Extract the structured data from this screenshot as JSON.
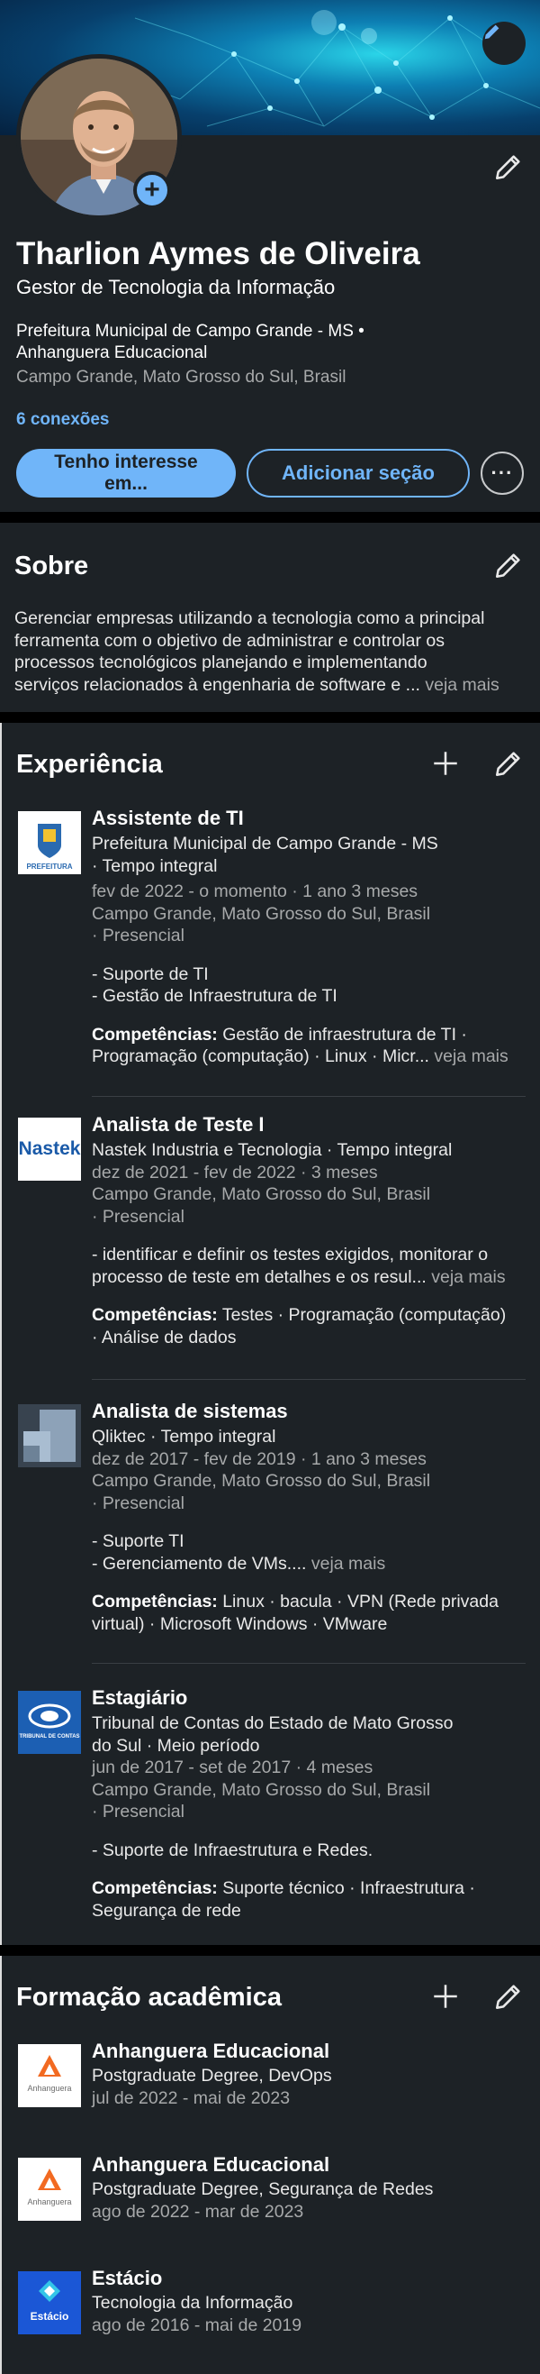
{
  "profile": {
    "name": "Tharlion Aymes de Oliveira",
    "headline": "Gestor de Tecnologia da Informação",
    "orgs_line1": "Prefeitura Municipal de Campo Grande - MS •",
    "orgs_line2": "Anhanguera Educacional",
    "location": "Campo Grande, Mato Grosso do Sul, Brasil",
    "connections": "6 conexões",
    "open_to_line1": "Tenho interesse",
    "open_to_line2": "em...",
    "add_section": "Adicionar seção",
    "more": "···"
  },
  "about": {
    "title": "Sobre",
    "text_lines": [
      "Gerenciar empresas utilizando a tecnologia como a principal",
      "ferramenta com o objetivo de administrar  e controlar os",
      "processos tecnológicos planejando e implementando",
      "serviços relacionados à engenharia de software e ..."
    ],
    "see_more": "veja mais"
  },
  "experience": {
    "title": "Experiência",
    "items": [
      {
        "role": "Assistente de TI",
        "company_line1": "Prefeitura Municipal de Campo Grande - MS",
        "company_line2": "· Tempo integral",
        "dates": "fev de 2022 - o momento · 1 ano 3 meses",
        "location_line1": "Campo Grande, Mato Grosso do Sul, Brasil",
        "location_line2": "· Presencial",
        "desc_line1": "- Suporte de TI",
        "desc_line2": "- Gestão de Infraestrutura de TI",
        "skills_label": "Competências:",
        "skills_line1": " Gestão de infraestrutura de TI ·",
        "skills_line2": "Programação (computação) · Linux · Micr...",
        "see_more": "veja mais",
        "logo_text": "PREFEITURA"
      },
      {
        "role": "Analista de Teste I",
        "company_line1": "Nastek Industria e Tecnologia · Tempo integral",
        "dates": "dez de 2021 - fev de 2022 · 3 meses",
        "location_line1": "Campo Grande, Mato Grosso do Sul, Brasil",
        "location_line2": "· Presencial",
        "desc_line1": "- identificar e definir os testes exigidos, monitorar o",
        "desc_line2": "processo de teste em detalhes e os resul...",
        "see_more": "veja mais",
        "skills_label": "Competências:",
        "skills_line1": " Testes · Programação (computação)",
        "skills_line2": "· Análise de dados",
        "logo_text": "Nastek"
      },
      {
        "role": "Analista de sistemas",
        "company_line1": "Qliktec · Tempo integral",
        "dates": "dez de 2017 - fev de 2019 · 1 ano 3 meses",
        "location_line1": "Campo Grande, Mato Grosso do Sul, Brasil",
        "location_line2": "· Presencial",
        "desc_line1": "- Suporte TI",
        "desc_line2": "- Gerenciamento de VMs....",
        "see_more": "veja mais",
        "skills_label": "Competências:",
        "skills_line1": " Linux · bacula · VPN (Rede privada",
        "skills_line2": "virtual) · Microsoft Windows · VMware"
      },
      {
        "role": "Estagiário",
        "company_line1": "Tribunal de Contas do Estado de Mato Grosso",
        "company_line2": "do Sul · Meio período",
        "dates": "jun de 2017 - set de 2017 · 4 meses",
        "location_line1": "Campo Grande, Mato Grosso do Sul, Brasil",
        "location_line2": "· Presencial",
        "desc_line1": "- Suporte de Infraestrutura e Redes.",
        "skills_label": "Competências:",
        "skills_line1": " Suporte técnico · Infraestrutura ·",
        "skills_line2": "Segurança de rede",
        "logo_text": "TRIBUNAL DE CONTAS"
      }
    ]
  },
  "education": {
    "title": "Formação acadêmica",
    "items": [
      {
        "school": "Anhanguera Educacional",
        "degree": "Postgraduate Degree, DevOps",
        "dates": "jul de 2022 - mai de 2023",
        "logo_text": "Anhanguera"
      },
      {
        "school": "Anhanguera Educacional",
        "degree": "Postgraduate Degree, Segurança de Redes",
        "dates": "ago de 2022 - mar de 2023",
        "logo_text": "Anhanguera"
      },
      {
        "school": "Estácio",
        "degree": "Tecnologia da Informação",
        "dates": "ago de 2016 - mai de 2019",
        "logo_text": "Estácio"
      }
    ]
  },
  "colors": {
    "background": "#000000",
    "card": "#1d2226",
    "accent": "#70b5f9",
    "muted_text": "#a7a9aa"
  },
  "icons": [
    "pencil-icon",
    "plus-icon",
    "more-icon"
  ]
}
